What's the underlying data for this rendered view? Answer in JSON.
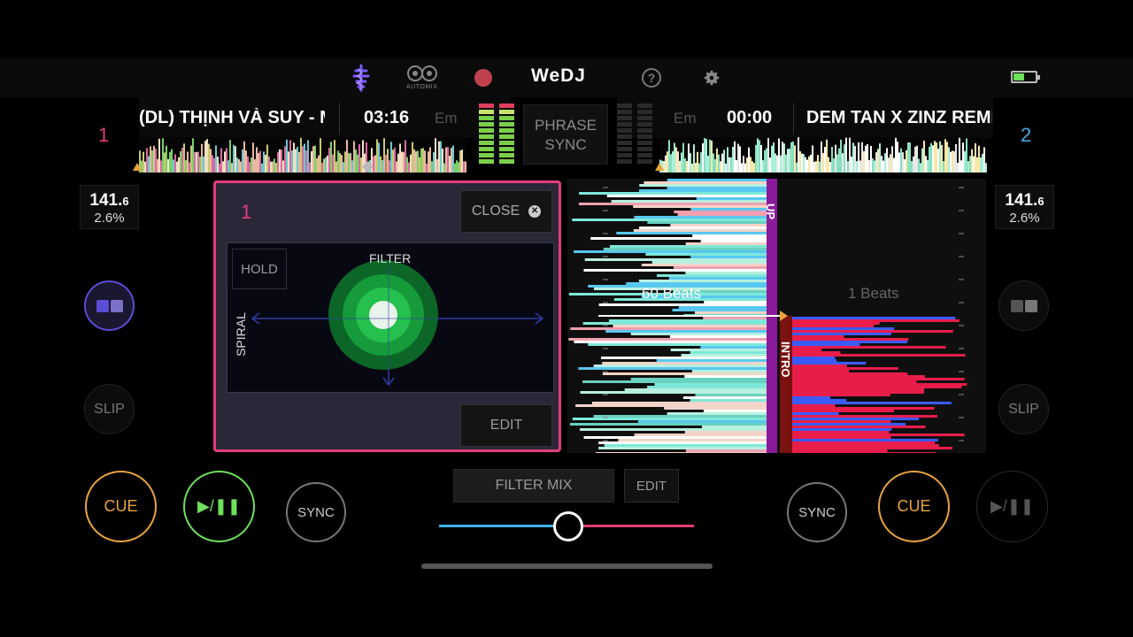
{
  "app": {
    "logo": "WeDJ",
    "automix_label": "AUTOMIX"
  },
  "deck1": {
    "number": "1",
    "title": "(DL) THỊNH VÀ SUY - MỘ",
    "time": "03:16",
    "key": "Em",
    "bpm": "141.",
    "bpm_decimal": "6",
    "pitch": "2.6%",
    "slip_label": "SLIP",
    "cue_label": "CUE",
    "play_label": "▶/❚❚",
    "sync_label": "SYNC",
    "beats_label": "60 Beats",
    "phrase_label": "UP"
  },
  "deck2": {
    "number": "2",
    "title": "DEM TAN X ZINZ REMIX",
    "time": "00:00",
    "key": "Em",
    "bpm": "141.",
    "bpm_decimal": "6",
    "pitch": "2.6%",
    "slip_label": "SLIP",
    "cue_label": "CUE",
    "play_label": "▶/❚❚",
    "sync_label": "SYNC",
    "beats_label": "1 Beats",
    "phrase_label": "INTRO"
  },
  "center": {
    "phrase_sync_line1": "PHRASE",
    "phrase_sync_line2": "SYNC",
    "filter_mix_label": "FILTER MIX",
    "edit_label": "EDIT",
    "crossfader_position": 0.5
  },
  "fx_panel": {
    "deck": "1",
    "close_label": "CLOSE",
    "hold_label": "HOLD",
    "x_axis_label": "FILTER",
    "y_axis_label": "SPIRAL",
    "edit_label": "EDIT"
  },
  "colors": {
    "deck1_accent": "#e23d7b",
    "deck2_accent": "#4aa8e0",
    "cue": "#e8a33d",
    "play_active": "#6ee05a",
    "sync": "#9a9a9a",
    "record": "#c0414e"
  },
  "icons": {
    "waveform": "waveform-icon",
    "automix": "automix-icon",
    "record": "record-icon",
    "help": "help-icon",
    "settings": "gear-icon",
    "battery": "battery-icon"
  }
}
